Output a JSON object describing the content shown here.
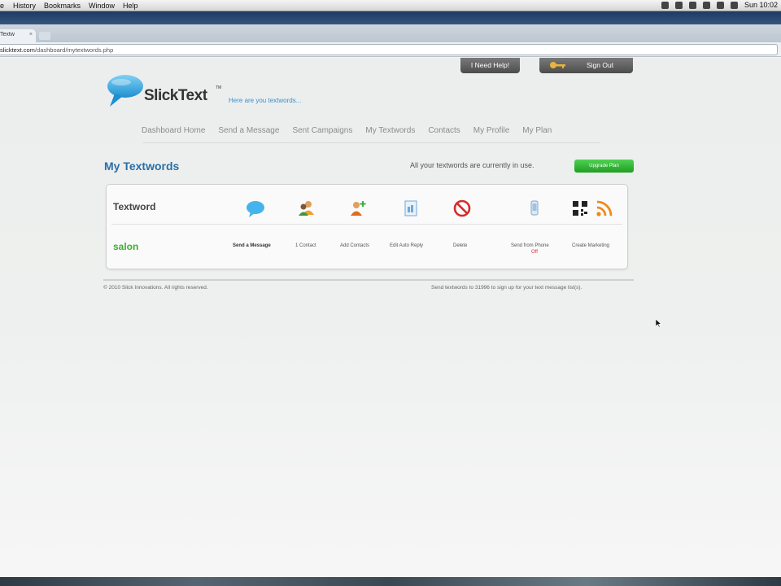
{
  "menubar": {
    "items": [
      "e",
      "History",
      "Bookmarks",
      "Window",
      "Help"
    ],
    "clock": "Sun 10:02"
  },
  "browser": {
    "tab_title": "Textw",
    "url_host": "slicktext.com",
    "url_path": "/dashboard/mytextwords.php"
  },
  "header": {
    "help_label": "I Need Help!",
    "signout_label": "Sign Out",
    "brand": "SlickText",
    "trademark": "TM",
    "tagline": "Here are you textwords..."
  },
  "nav": {
    "items": [
      "Dashboard Home",
      "Send a Message",
      "Sent Campaigns",
      "My Textwords",
      "Contacts",
      "My Profile",
      "My Plan"
    ]
  },
  "main": {
    "title": "My Textwords",
    "status": "All your textwords are currently in use.",
    "upgrade_label": "Upgrade Plan"
  },
  "table": {
    "header_label": "Textword",
    "header_icons": [
      "speech-bubble-icon",
      "contact-icon",
      "add-contact-icon",
      "document-icon",
      "no-entry-icon",
      "phone-icon",
      "qr-code-icon",
      "rss-icon"
    ],
    "row": {
      "word": "salon",
      "actions": [
        "Send a Message",
        "1 Contact",
        "Add Contacts",
        "Edit Auto Reply",
        "Delete",
        "Send from Phone",
        "Create Marketing"
      ],
      "phone_state": "Off"
    }
  },
  "footer": {
    "copyright": "© 2010 Slick Innovations. All rights reserved.",
    "note": "Send textwords to 31996 to sign up for your text message list(s)."
  },
  "colors": {
    "accent_blue": "#2b6fa6",
    "word_green": "#3bb22e",
    "upgrade_green": "#1f9e23"
  }
}
